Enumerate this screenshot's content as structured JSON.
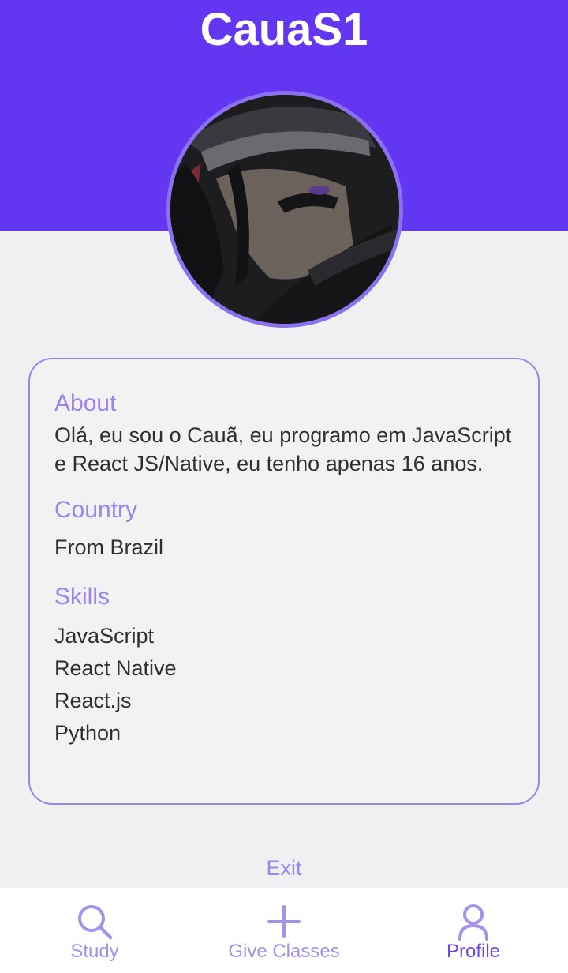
{
  "header": {
    "username": "CauaS1"
  },
  "profile": {
    "avatar_icon": "user-avatar-photo"
  },
  "card": {
    "about": {
      "title": "About",
      "text": "Olá, eu sou o Cauã, eu programo em JavaScript e React JS/Native, eu tenho apenas 16 anos."
    },
    "country": {
      "title": "Country",
      "text": "From Brazil"
    },
    "skills": {
      "title": "Skills",
      "items": [
        "JavaScript",
        "React Native",
        "React.js",
        "Python"
      ]
    }
  },
  "exit_label": "Exit",
  "tabbar": {
    "tabs": [
      {
        "label": "Study",
        "icon": "search-icon",
        "active": false
      },
      {
        "label": "Give Classes",
        "icon": "plus-icon",
        "active": false
      },
      {
        "label": "Profile",
        "icon": "user-icon",
        "active": true
      }
    ]
  },
  "colors": {
    "brand": "#6337f2",
    "accent_light": "#9b85ec",
    "tab_active": "#6a48e6",
    "background": "#f0f0f2"
  }
}
